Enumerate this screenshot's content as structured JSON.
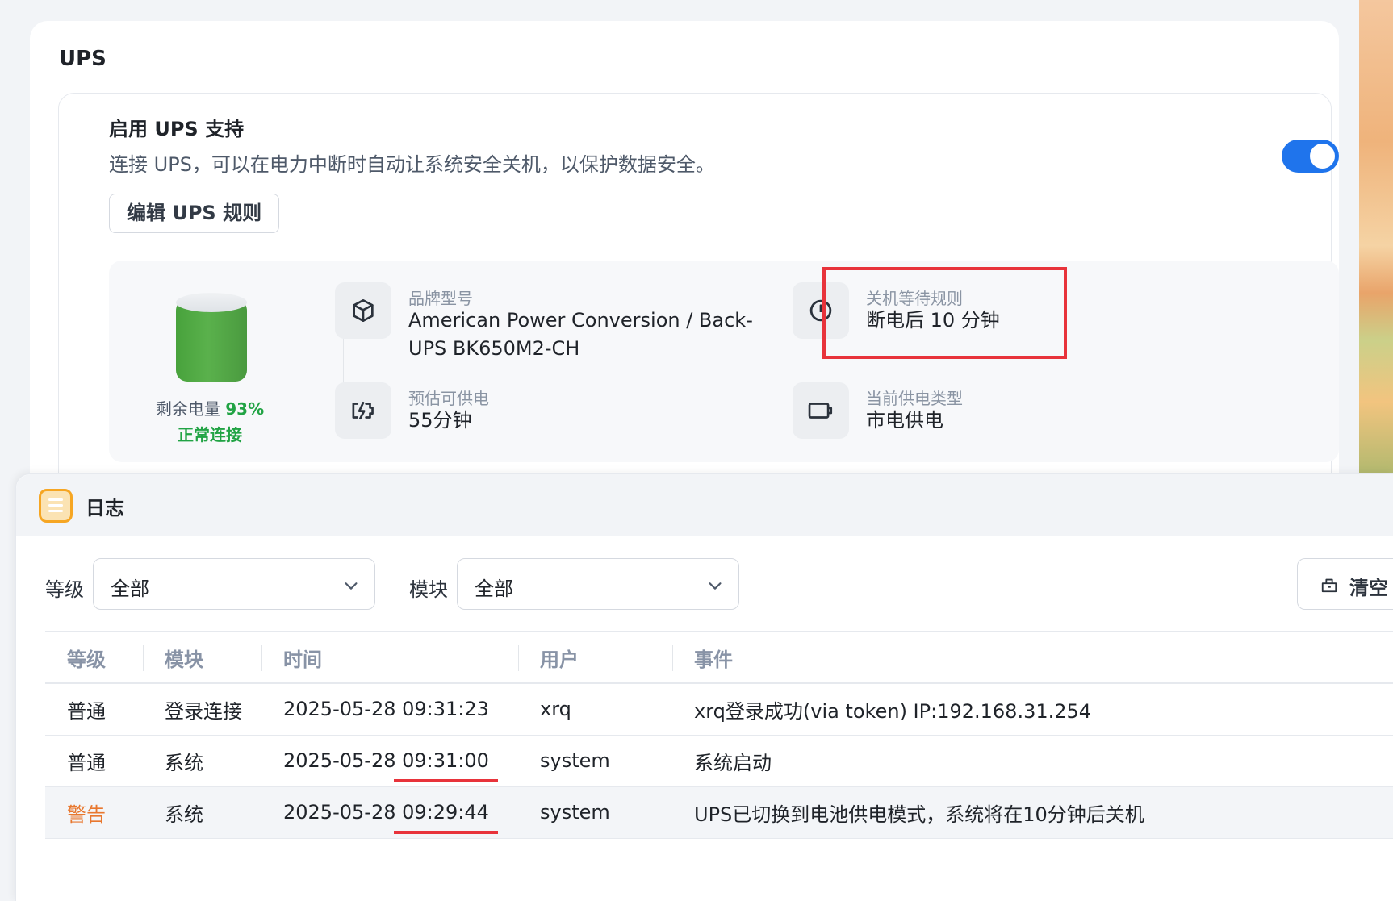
{
  "ups": {
    "title": "UPS",
    "enable": {
      "title": "启用 UPS 支持",
      "description": "连接 UPS，可以在电力中断时自动让系统安全关机，以保护数据安全。",
      "enabled": true
    },
    "edit_button": "编辑 UPS 规则",
    "battery": {
      "level_label": "剩余电量",
      "level_value": "93%",
      "status": "正常连接"
    },
    "info": {
      "model": {
        "label": "品牌型号",
        "value": "American Power Conversion / Back-UPS BK650M2-CH",
        "icon": "cube-icon"
      },
      "shutdown_rule": {
        "label": "关机等待规则",
        "value": "断电后 10 分钟",
        "icon": "clock-icon"
      },
      "runtime": {
        "label": "预估可供电",
        "value": "55分钟",
        "icon": "battery-charging-icon"
      },
      "power_type": {
        "label": "当前供电类型",
        "value": "市电供电",
        "icon": "battery-outline-icon"
      }
    }
  },
  "log": {
    "title": "日志",
    "filters": {
      "level": {
        "label": "等级",
        "value": "全部"
      },
      "module": {
        "label": "模块",
        "value": "全部"
      }
    },
    "clear_button": "清空",
    "columns": [
      "等级",
      "模块",
      "时间",
      "用户",
      "事件"
    ],
    "rows": [
      {
        "level": "普通",
        "module": "登录连接",
        "date": "2025-05-28",
        "time": "09:31:23",
        "user": "xrq",
        "event": "xrq登录成功(via token) IP:192.168.31.254",
        "warning": false
      },
      {
        "level": "普通",
        "module": "系统",
        "date": "2025-05-28",
        "time": "09:31:00",
        "user": "system",
        "event": "系统启动",
        "warning": false
      },
      {
        "level": "警告",
        "module": "系统",
        "date": "2025-05-28",
        "time": "09:29:44",
        "user": "system",
        "event": "UPS已切换到电池供电模式，系统将在10分钟后关机",
        "warning": true
      }
    ]
  },
  "colors": {
    "accent": "#1f74ec",
    "success": "#21a344",
    "warning": "#e8772e",
    "annotation": "#e8333b"
  }
}
